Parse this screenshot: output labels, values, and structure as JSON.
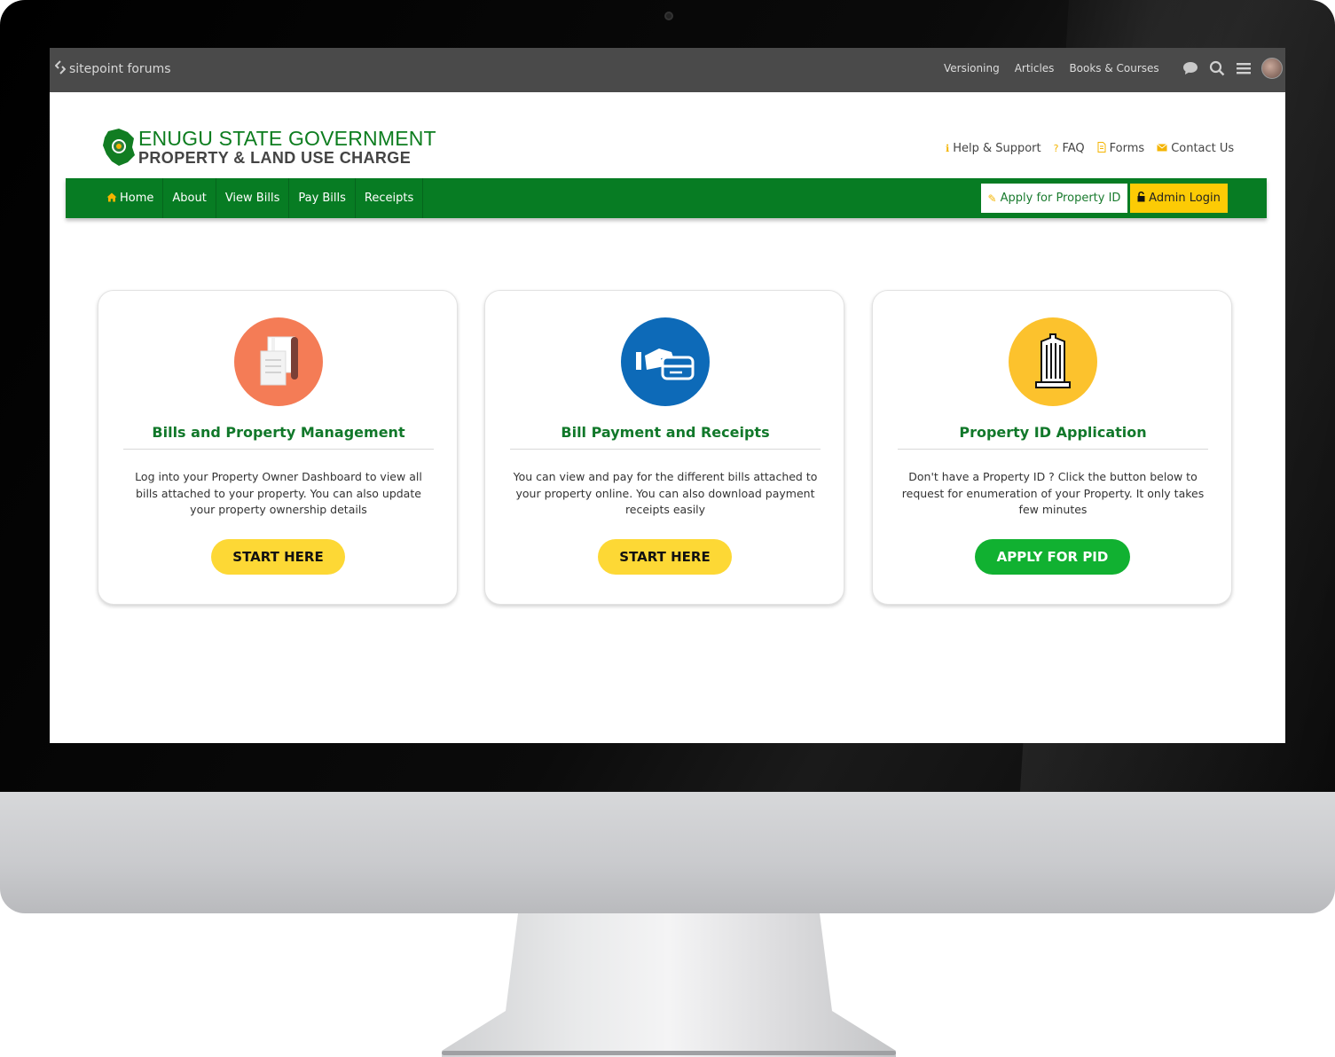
{
  "forum_bar": {
    "brand": "sitepoint forums",
    "links": [
      "Versioning",
      "Articles",
      "Books & Courses"
    ],
    "icons": [
      "chat-bubble-icon",
      "search-icon",
      "hamburger-menu-icon",
      "user-avatar"
    ]
  },
  "header": {
    "logo_line1": "ENUGU STATE GOVERNMENT",
    "logo_line2": "PROPERTY & LAND USE CHARGE",
    "top_links": [
      {
        "icon": "info-icon",
        "label": "Help & Support"
      },
      {
        "icon": "question-icon",
        "label": "FAQ"
      },
      {
        "icon": "document-icon",
        "label": "Forms"
      },
      {
        "icon": "envelope-icon",
        "label": "Contact Us"
      }
    ]
  },
  "nav": {
    "items": [
      "Home",
      "About",
      "View Bills",
      "Pay Bills",
      "Receipts"
    ],
    "apply_button": "Apply for Property ID",
    "admin_button": "Admin Login"
  },
  "cards": [
    {
      "icon": "documents-icon",
      "icon_color": "#f47c56",
      "title": "Bills and Property Management",
      "description": "Log into your Property Owner Dashboard to view all bills attached to your property. You can also update your property ownership details",
      "button": "START HERE"
    },
    {
      "icon": "card-payment-icon",
      "icon_color": "#0d6ab8",
      "title": "Bill Payment and Receipts",
      "description": "You can view and pay for the different bills attached to your property online. You can also download payment receipts easily",
      "button": "START HERE"
    },
    {
      "icon": "building-icon",
      "icon_color": "#fcc22d",
      "title": "Property ID Application",
      "description": "Don't have a Property ID ? Click the button below to request for enumeration of your Property. It only takes few minutes",
      "button": "APPLY FOR PID"
    }
  ],
  "colors": {
    "brand_green": "#077c23",
    "accent_yellow": "#fccb05",
    "button_green": "#11b131"
  }
}
